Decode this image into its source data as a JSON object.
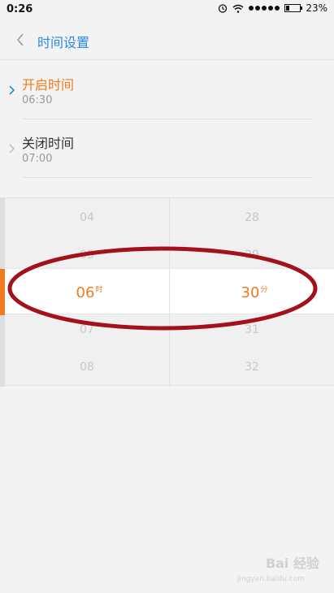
{
  "status_bar": {
    "time": "0:26",
    "battery_percent": "23%",
    "battery_level": 0.23,
    "icons": [
      "alarm-icon",
      "wifi-icon",
      "signal-icon",
      "battery-icon"
    ]
  },
  "header": {
    "title": "时间设置"
  },
  "list": {
    "items": [
      {
        "title": "开启时间",
        "time": "06:30",
        "active": true
      },
      {
        "title": "关闭时间",
        "time": "07:00",
        "active": false
      }
    ]
  },
  "picker": {
    "hours": [
      "04",
      "05",
      "06",
      "07",
      "08"
    ],
    "minutes": [
      "28",
      "29",
      "30",
      "31",
      "32"
    ],
    "selected_hour": "06",
    "hour_unit": "时",
    "selected_minute": "30",
    "minute_unit": "分"
  },
  "watermark": {
    "text": "Bai 经验",
    "sub": "jingyan.baidu.com"
  },
  "colors": {
    "accent": "#f07a1e",
    "header_title": "#2a8ae5",
    "annotation": "#a3121a"
  }
}
